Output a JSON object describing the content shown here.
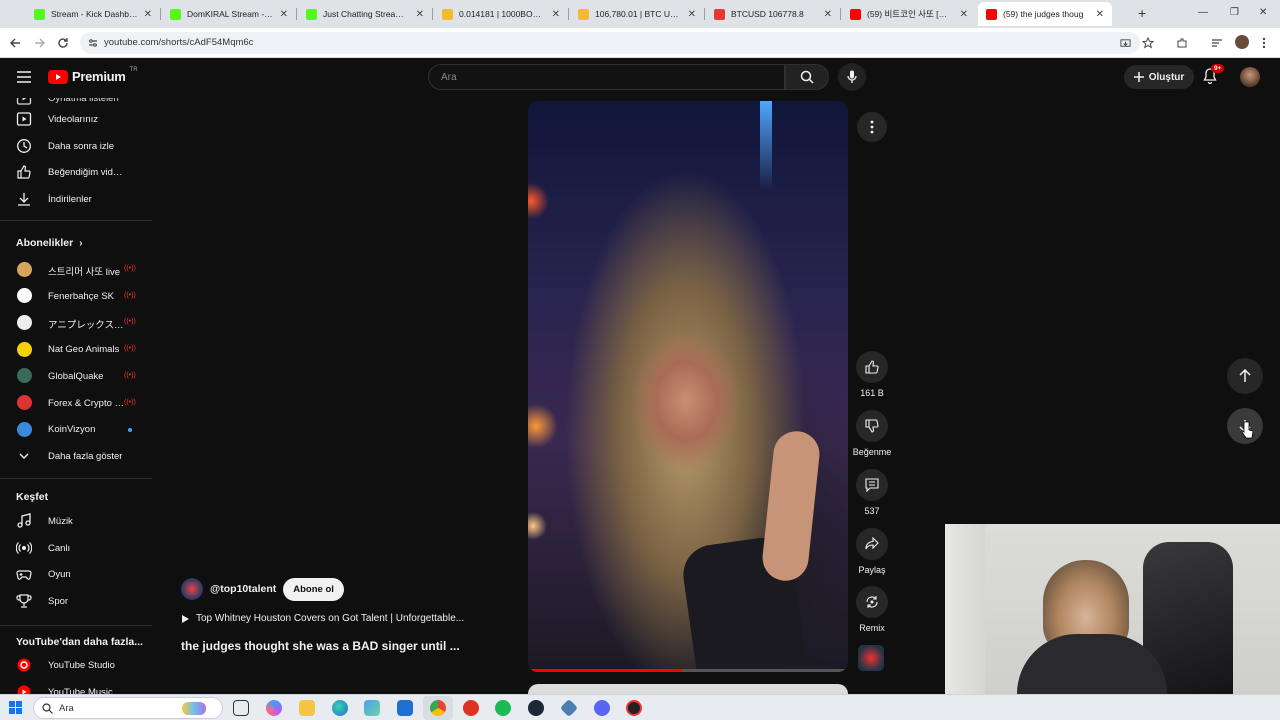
{
  "browser": {
    "tabs": [
      {
        "title": "Stream - Kick Dashboard",
        "favicon": "kick-icon",
        "color": "#53fc18"
      },
      {
        "title": "DomKIRAL Stream - Watch",
        "favicon": "kick-icon",
        "color": "#53fc18"
      },
      {
        "title": "Just Chatting Streaming -",
        "favicon": "kick-icon",
        "color": "#53fc18"
      },
      {
        "title": "0.014181 | 1000BONKUSD",
        "favicon": "binance-icon",
        "color": "#f3ba2f"
      },
      {
        "title": "106,780.01 | BTC USDT | B",
        "favicon": "binance-icon",
        "color": "#f3ba2f"
      },
      {
        "title": "BTCUSD 106778.8",
        "favicon": "tradingview-icon",
        "color": "#e53935"
      },
      {
        "title": "(59) 비트코인 사또 [비트",
        "favicon": "youtube-icon",
        "color": "#ff0000"
      },
      {
        "title": "(59) the judges thoug",
        "favicon": "youtube-icon",
        "color": "#ff0000",
        "active": true
      }
    ],
    "url": "youtube.com/shorts/cAdF54Mqm6c"
  },
  "header": {
    "logo_text": "Premium",
    "logo_region": "TR",
    "search_placeholder": "Ara",
    "create_label": "Oluştur",
    "notification_count": "9+"
  },
  "sidebar": {
    "top_partial": "Oynatma listeleri",
    "items": [
      {
        "label": "Videolarınız",
        "icon": "play-square-icon"
      },
      {
        "label": "Daha sonra izle",
        "icon": "clock-icon"
      },
      {
        "label": "Beğendiğim videolar",
        "icon": "thumbs-up-icon"
      },
      {
        "label": "İndirilenler",
        "icon": "download-icon"
      }
    ],
    "subscriptions_heading": "Abonelikler",
    "subscriptions": [
      {
        "label": "스트리머 사또 live",
        "color": "#d9a45a",
        "live": true
      },
      {
        "label": "Fenerbahçe SK",
        "color": "#ffffff",
        "live": true
      },
      {
        "label": "アニプレックス チャンネル",
        "color": "#eeeeee",
        "live": true
      },
      {
        "label": "Nat Geo Animals",
        "color": "#f6d000",
        "live": true
      },
      {
        "label": "GlobalQuake",
        "color": "#3a6b5a",
        "live": true
      },
      {
        "label": "Forex & Crypto Live",
        "color": "#d33",
        "live": true
      },
      {
        "label": "KoinVizyon",
        "color": "#3a8ad9",
        "live": false
      }
    ],
    "show_more": "Daha fazla göster",
    "explore_heading": "Keşfet",
    "explore": [
      {
        "label": "Müzik",
        "icon": "music-icon"
      },
      {
        "label": "Canlı",
        "icon": "live-icon"
      },
      {
        "label": "Oyun",
        "icon": "gamepad-icon"
      },
      {
        "label": "Spor",
        "icon": "trophy-icon"
      }
    ],
    "more_heading": "YouTube'dan daha fazla...",
    "more": [
      {
        "label": "YouTube Studio",
        "icon": "studio-icon"
      },
      {
        "label": "YouTube Music",
        "icon": "yt-music-icon"
      }
    ]
  },
  "short": {
    "channel": "@top10talent",
    "subscribe_label": "Abone ol",
    "song": "Top Whitney Houston Covers on Got Talent | Unforgettable...",
    "title": "the judges thought she was a BAD singer until ...",
    "progress": 0.48,
    "actions": {
      "like_count": "161 B",
      "dislike_label": "Beğenme",
      "comment_count": "537",
      "share_label": "Paylaş",
      "remix_label": "Remix"
    }
  },
  "taskbar": {
    "search_placeholder": "Ara"
  }
}
